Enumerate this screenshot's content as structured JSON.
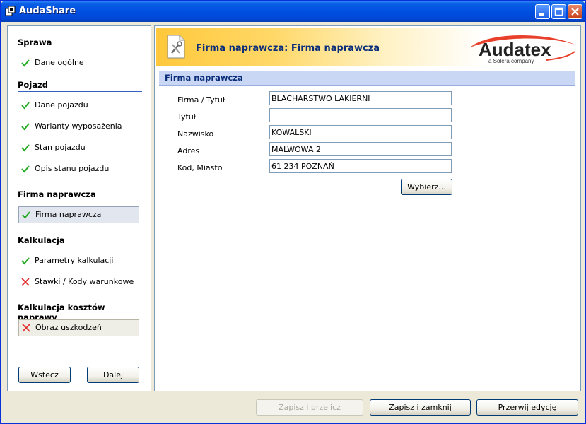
{
  "window": {
    "title": "AudaShare"
  },
  "sidebar": {
    "sections": [
      {
        "title": "Sprawa",
        "items": [
          {
            "label": "Dane ogólne",
            "status": "ok"
          }
        ]
      },
      {
        "title": "Pojazd",
        "items": [
          {
            "label": "Dane pojazdu",
            "status": "ok"
          },
          {
            "label": "Warianty wyposażenia",
            "status": "ok"
          },
          {
            "label": "Stan pojazdu",
            "status": "ok"
          },
          {
            "label": "Opis stanu pojazdu",
            "status": "ok"
          }
        ]
      },
      {
        "title": "Firma naprawcza",
        "items": [
          {
            "label": "Firma naprawcza",
            "status": "ok",
            "selected": true
          }
        ]
      },
      {
        "title": "Kalkulacja",
        "items": [
          {
            "label": "Parametry kalkulacji",
            "status": "ok"
          },
          {
            "label": "Stawki / Kody warunkowe",
            "status": "error"
          }
        ]
      },
      {
        "title": "Kalkulacja kosztów naprawy",
        "items": [
          {
            "label": "Obraz uszkodzeń",
            "status": "error"
          }
        ]
      }
    ],
    "back_label": "Wstecz",
    "next_label": "Dalej"
  },
  "main": {
    "banner_title": "Firma naprawcza: Firma naprawcza",
    "logo": {
      "brand": "Audatex",
      "tagline": "a Solera company"
    },
    "section_title": "Firma naprawcza",
    "fields": [
      {
        "label": "Firma / Tytuł",
        "value": "BLACHARSTWO LAKIERNI"
      },
      {
        "label": "Tytuł",
        "value": ""
      },
      {
        "label": "Nazwisko",
        "value": "KOWALSKI"
      },
      {
        "label": "Adres",
        "value": "MALWOWA 2"
      },
      {
        "label": "Kod, Miasto",
        "value": "61 234 POZNAŃ"
      }
    ],
    "choose_label": "Wybierz..."
  },
  "footer": {
    "save_recalc_label": "Zapisz i przelicz",
    "save_close_label": "Zapisz i zamknij",
    "cancel_edit_label": "Przerwij edycję"
  },
  "colors": {
    "accent": "#0b2e7a",
    "ok": "#22aa22",
    "error": "#e03030",
    "logo_red": "#e8402a"
  },
  "icons": {
    "ok": "checkmark-icon",
    "error": "cross-icon"
  }
}
